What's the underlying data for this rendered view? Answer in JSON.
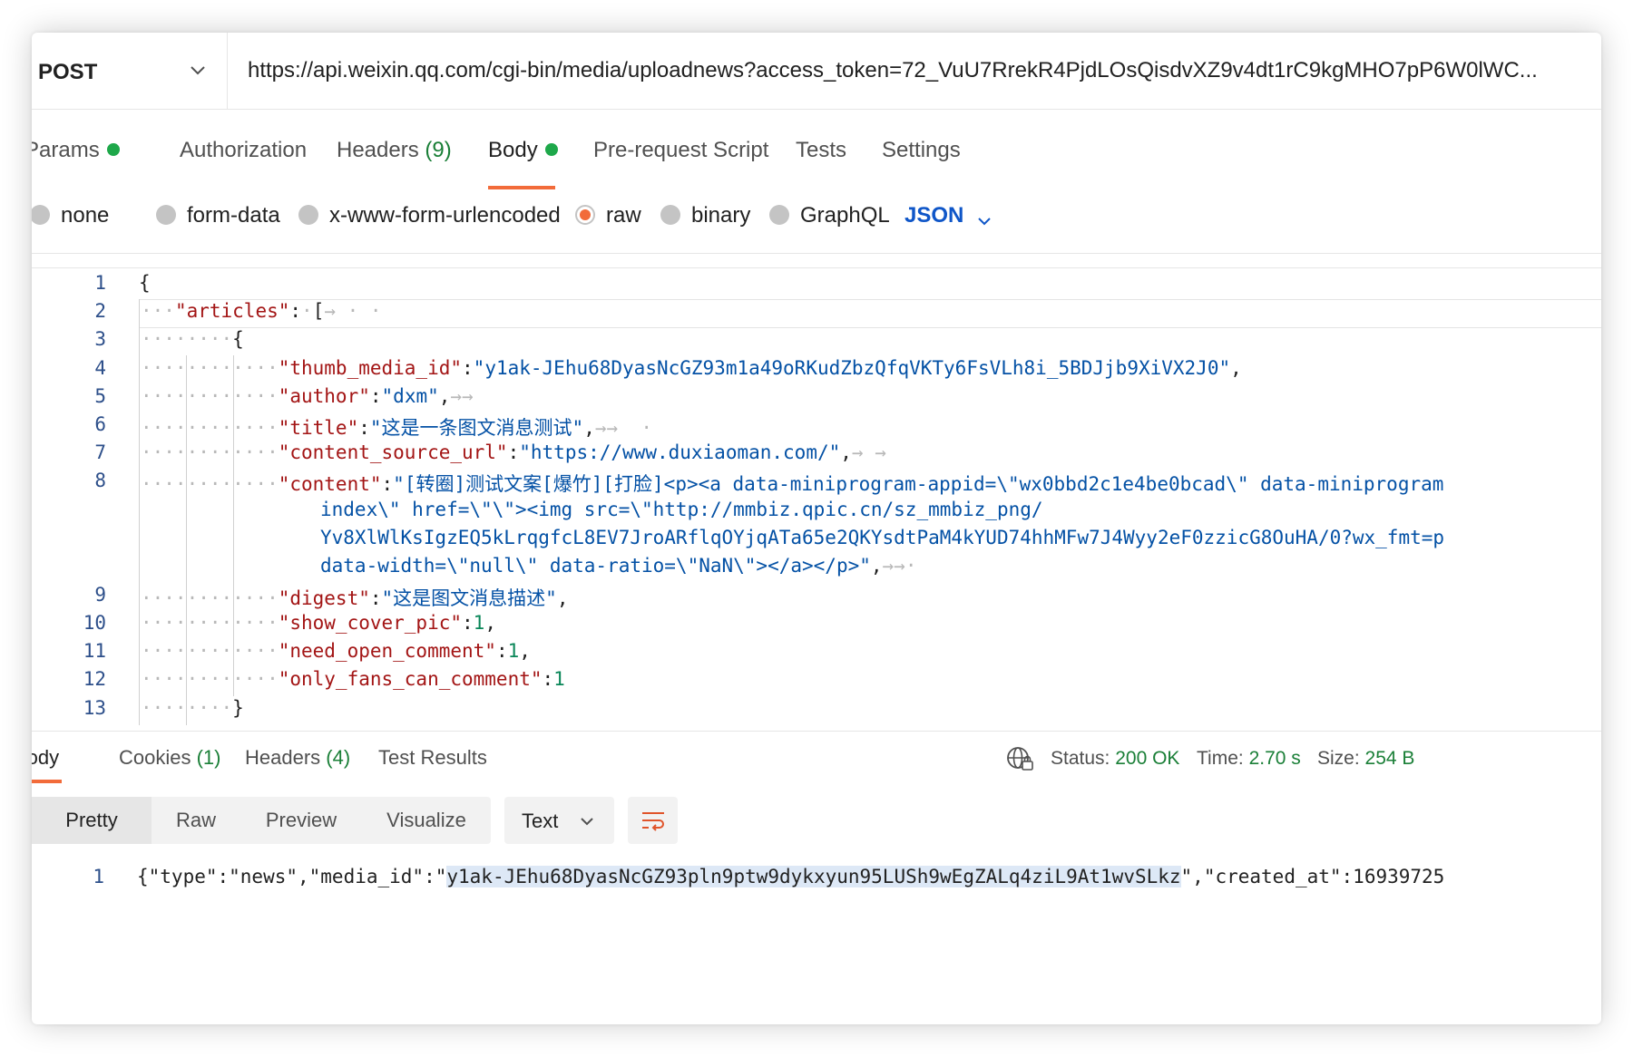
{
  "request": {
    "method": "POST",
    "url": "https://api.weixin.qq.com/cgi-bin/media/uploadnews?access_token=72_VuU7RrekR4PjdLOsQisdvXZ9v4dt1rC9kgMHO7pP6W0lWC..."
  },
  "tabs": {
    "params": "Params",
    "authorization": "Authorization",
    "headers": "Headers",
    "headers_count": "(9)",
    "body": "Body",
    "pre_request": "Pre-request Script",
    "tests": "Tests",
    "settings": "Settings"
  },
  "body_types": {
    "none": "none",
    "form_data": "form-data",
    "urlencoded": "x-www-form-urlencoded",
    "raw": "raw",
    "binary": "binary",
    "graphql": "GraphQL",
    "selected": "raw",
    "format": "JSON"
  },
  "editor": {
    "line_numbers": [
      "1",
      "2",
      "3",
      "4",
      "5",
      "6",
      "7",
      "8",
      "9",
      "10",
      "11",
      "12",
      "13"
    ],
    "open_brace": "{",
    "articles_key": "\"articles\"",
    "open_bracket": "[",
    "inner_open": "{",
    "thumb_key": "\"thumb_media_id\"",
    "thumb_val": "\"y1ak-JEhu68DyasNcGZ93m1a49oRKudZbzQfqVKTy6FsVLh8i_5BDJjb9XiVX2J0\"",
    "author_key": "\"author\"",
    "author_val": "\"dxm\"",
    "title_key": "\"title\"",
    "title_val": "\"这是一条图文消息测试\"",
    "url_key": "\"content_source_url\"",
    "url_val": "\"https://www.duxiaoman.com/\"",
    "content_key": "\"content\"",
    "content_1": "\"[转圈]测试文案[爆竹][打脸]<p><a data-miniprogram-appid=\\\"wx0bbd2c1e4be0bcad\\\" data-miniprogram",
    "content_2": "index\\\" href=\\\"\\\"><img src=\\\"http://mmbiz.qpic.cn/sz_mmbiz_png/",
    "content_3": "Yv8XlWlKsIgzEQ5kLrqgfcL8EV7JroARflqOYjqATa65e2QKYsdtPaM4kYUD74hhMFw7J4Wyy2eF0zzicG8OuHA/0?wx_fmt=p",
    "content_4": "data-width=\\\"null\\\" data-ratio=\\\"NaN\\\"></a></p>\"",
    "digest_key": "\"digest\"",
    "digest_val": "\"这是图文消息描述\"",
    "cover_key": "\"show_cover_pic\"",
    "cover_val": "1",
    "comment_key": "\"need_open_comment\"",
    "comment_val": "1",
    "fans_key": "\"only_fans_can_comment\"",
    "fans_val": "1",
    "inner_close": "}"
  },
  "response": {
    "tabs": {
      "body": "Body",
      "cookies": "Cookies",
      "cookies_count": "(1)",
      "headers": "Headers",
      "headers_count": "(4)",
      "test_results": "Test Results"
    },
    "status_label": "Status:",
    "status_value": "200 OK",
    "time_label": "Time:",
    "time_value": "2.70 s",
    "size_label": "Size:",
    "size_value": "254 B",
    "views": [
      "Pretty",
      "Raw",
      "Preview",
      "Visualize"
    ],
    "active_view": "Pretty",
    "format": "Text",
    "line_number": "1",
    "body_prefix": "{\"type\":\"news\",\"media_id\":\"",
    "media_id": "y1ak-JEhu68DyasNcGZ93pln9ptw9dykxyun95LUSh9wEgZALq4ziL9At1wvSLkz",
    "body_suffix": "\",\"created_at\":16939725"
  },
  "colors": {
    "accent": "#f26b3a",
    "success": "#1a7f37",
    "link_blue": "#0f56c8",
    "json_key": "#a31515",
    "json_string": "#0451a5",
    "json_number": "#098658"
  }
}
